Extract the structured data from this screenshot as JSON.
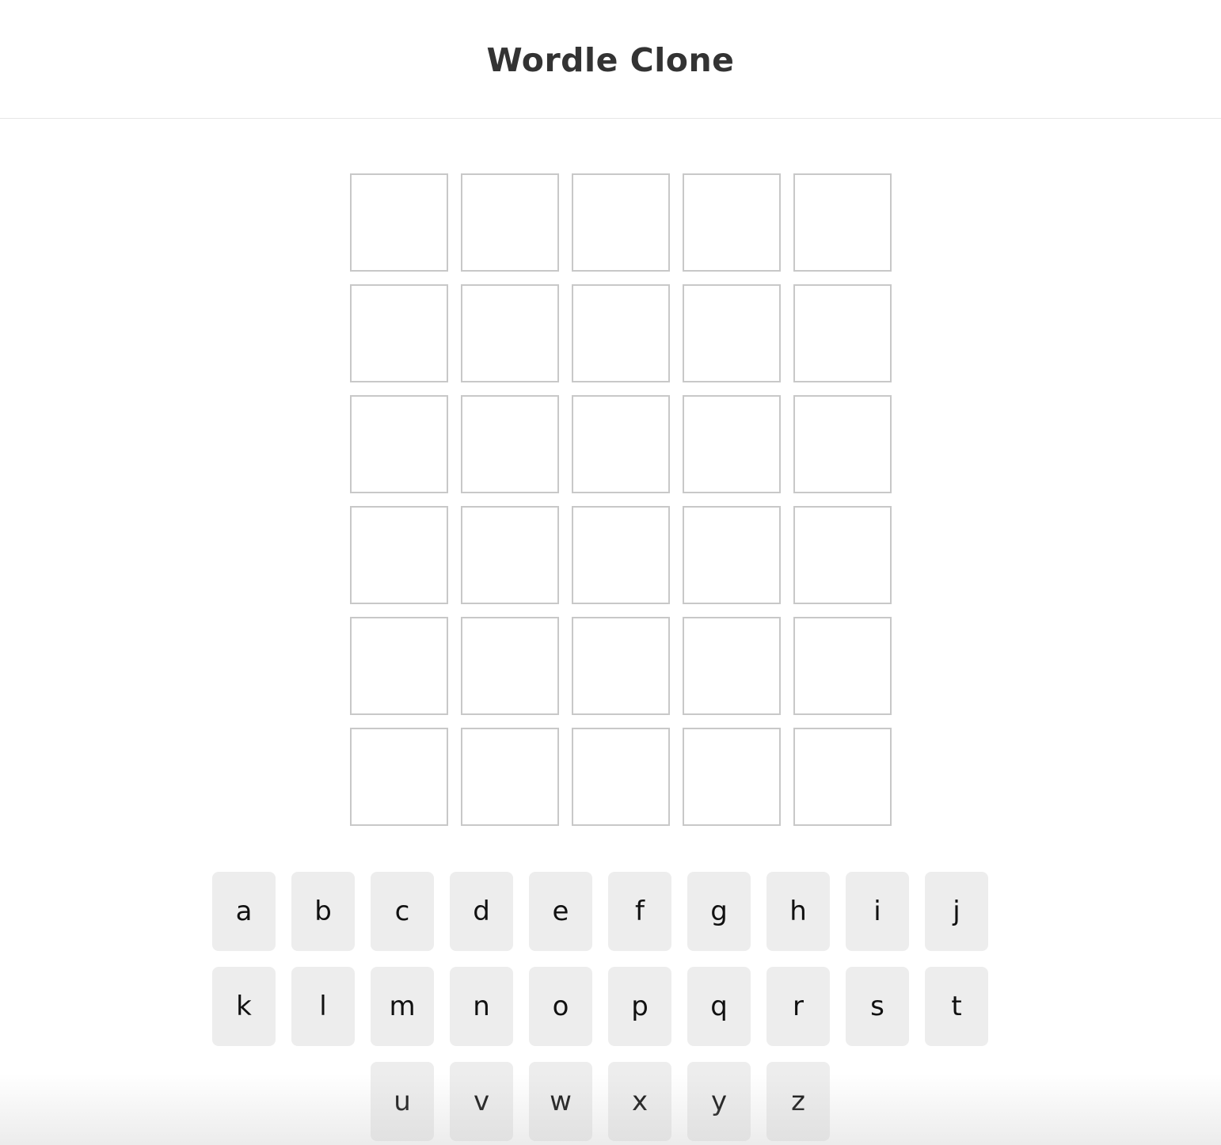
{
  "header": {
    "title": "Wordle Clone"
  },
  "board": {
    "rows": [
      [
        "",
        "",
        "",
        "",
        ""
      ],
      [
        "",
        "",
        "",
        "",
        ""
      ],
      [
        "",
        "",
        "",
        "",
        ""
      ],
      [
        "",
        "",
        "",
        "",
        ""
      ],
      [
        "",
        "",
        "",
        "",
        ""
      ],
      [
        "",
        "",
        "",
        "",
        ""
      ]
    ]
  },
  "keyboard": {
    "rows": [
      [
        "a",
        "b",
        "c",
        "d",
        "e",
        "f",
        "g",
        "h",
        "i",
        "j"
      ],
      [
        "k",
        "l",
        "m",
        "n",
        "o",
        "p",
        "q",
        "r",
        "s",
        "t"
      ],
      [
        "u",
        "v",
        "w",
        "x",
        "y",
        "z"
      ]
    ]
  },
  "colors": {
    "key_background": "#ededed",
    "tile_border": "#c8c8c8",
    "title_text": "#333333"
  }
}
